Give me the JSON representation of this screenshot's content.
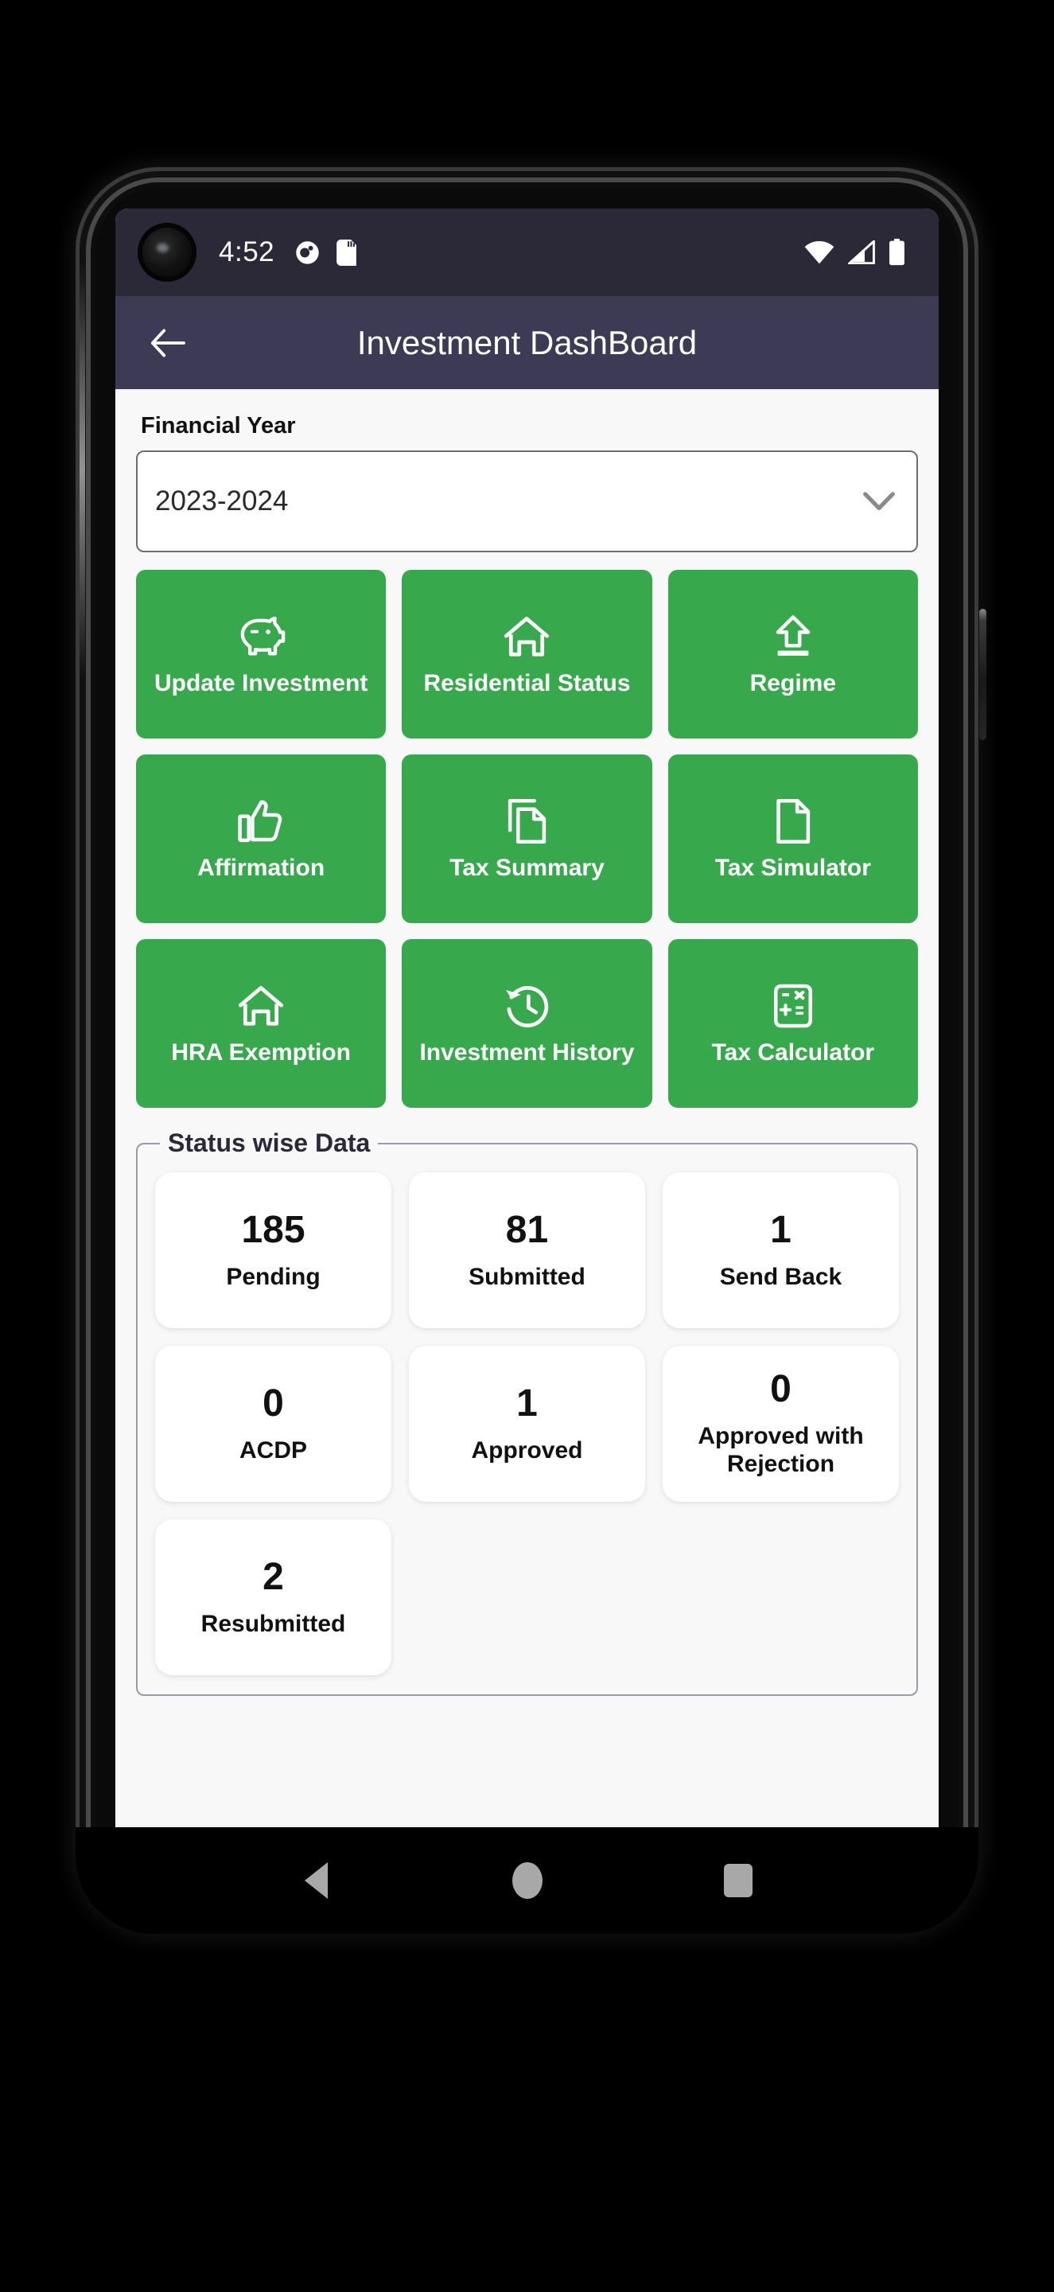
{
  "status_bar": {
    "time": "4:52",
    "left_icons": [
      "notification-dot-icon",
      "sd-card-icon"
    ],
    "right_icons": [
      "wifi-icon",
      "cellular-signal-icon",
      "battery-icon"
    ]
  },
  "app_bar": {
    "back_icon": "back-arrow-icon",
    "title": "Investment DashBoard"
  },
  "financial_year": {
    "label": "Financial Year",
    "selected": "2023-2024",
    "chevron_icon": "chevron-down-icon"
  },
  "tiles": [
    {
      "label": "Update Investment",
      "icon": "piggy-bank-icon"
    },
    {
      "label": "Residential Status",
      "icon": "home-icon"
    },
    {
      "label": "Regime",
      "icon": "upload-icon"
    },
    {
      "label": "Affirmation",
      "icon": "thumbs-up-icon"
    },
    {
      "label": "Tax Summary",
      "icon": "copy-documents-icon"
    },
    {
      "label": "Tax Simulator",
      "icon": "document-icon"
    },
    {
      "label": "HRA Exemption",
      "icon": "home-icon"
    },
    {
      "label": "Investment History",
      "icon": "history-clock-icon"
    },
    {
      "label": "Tax Calculator",
      "icon": "calculator-icon"
    }
  ],
  "status_section": {
    "legend": "Status wise Data",
    "cards": [
      {
        "count": "185",
        "name": "Pending"
      },
      {
        "count": "81",
        "name": "Submitted"
      },
      {
        "count": "1",
        "name": "Send Back"
      },
      {
        "count": "0",
        "name": "ACDP"
      },
      {
        "count": "1",
        "name": "Approved"
      },
      {
        "count": "0",
        "name": "Approved with Rejection"
      },
      {
        "count": "2",
        "name": "Resubmitted"
      }
    ]
  },
  "nav_bar": {
    "back": "nav-back-icon",
    "home": "nav-home-icon",
    "recents": "nav-recents-icon"
  },
  "colors": {
    "tile_green": "#37a94c",
    "app_bar": "#3c3a55",
    "status_bar": "#2b2838",
    "page_bg": "#f8f8f8"
  }
}
